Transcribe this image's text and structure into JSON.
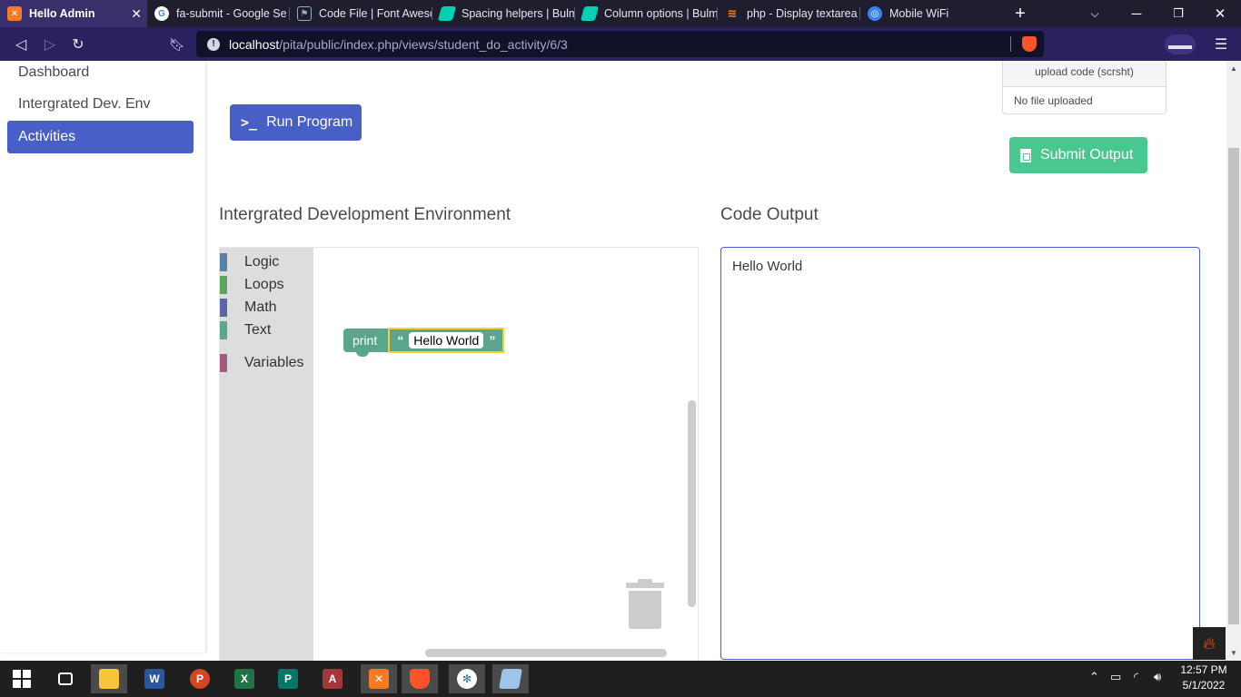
{
  "browser": {
    "tabs": [
      {
        "title": "Hello Admin",
        "active": true,
        "favicon": "xampp-icon",
        "color": "#fb7a24"
      },
      {
        "title": "fa-submit - Google Se",
        "active": false,
        "favicon": "google-icon",
        "color": "#ffffff"
      },
      {
        "title": "Code File | Font Aweso",
        "active": false,
        "favicon": "flag-icon",
        "color": "#1e1e2e"
      },
      {
        "title": "Spacing helpers | Bulm",
        "active": false,
        "favicon": "bulma-icon",
        "color": "#00d1b2"
      },
      {
        "title": "Column options | Bulm",
        "active": false,
        "favicon": "bulma-icon",
        "color": "#00d1b2"
      },
      {
        "title": "php - Display textarea",
        "active": false,
        "favicon": "stackoverflow-icon",
        "color": "#f48024"
      },
      {
        "title": "Mobile WiFi",
        "active": false,
        "favicon": "globe-icon",
        "color": "#3b82f6"
      }
    ],
    "url_host": "localhost",
    "url_path": "/pita/public/index.php/views/student_do_activity/6/3"
  },
  "sidebar": {
    "items": [
      {
        "label": "Dashboard",
        "active": false
      },
      {
        "label": "Intergrated Dev. Env",
        "active": false
      },
      {
        "label": "Activities",
        "active": true
      }
    ]
  },
  "toolbar": {
    "run_label": "Run Program",
    "upload_label": "upload code (scrsht)",
    "upload_filename": "No file uploaded",
    "submit_label": "Submit Output"
  },
  "ide": {
    "title": "Intergrated Development Environment",
    "categories": [
      {
        "label": "Logic",
        "color": "#5b80a5"
      },
      {
        "label": "Loops",
        "color": "#5ba55b"
      },
      {
        "label": "Math",
        "color": "#5b67a5"
      },
      {
        "label": "Text",
        "color": "#5ba58c"
      },
      {
        "label": "Variables",
        "color": "#a55b80"
      }
    ],
    "block": {
      "keyword": "print",
      "open_quote": "“",
      "text": "Hello World",
      "close_quote": "”"
    }
  },
  "output": {
    "title": "Code Output",
    "text": "Hello World"
  },
  "taskbar": {
    "time": "12:57 PM",
    "date": "5/1/2022"
  },
  "colors": {
    "primary": "#485fc7",
    "success": "#48c78e",
    "text_block": "#5ba58c"
  }
}
